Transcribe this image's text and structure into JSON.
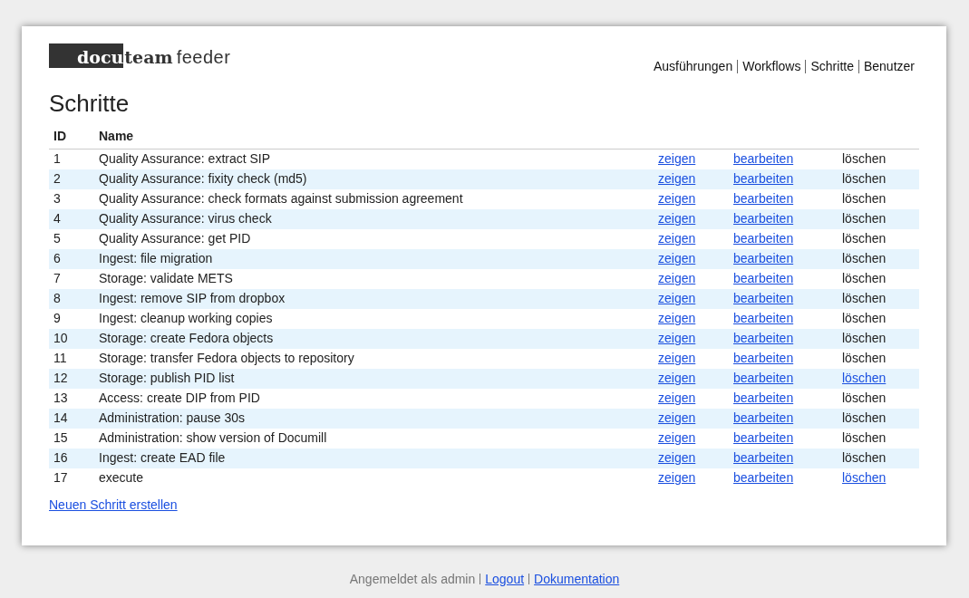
{
  "logo": {
    "dark_part": "docu",
    "bold_part": "team",
    "light_part": "feeder"
  },
  "nav": [
    "Ausführungen",
    "Workflows",
    "Schritte",
    "Benutzer"
  ],
  "heading": "Schritte",
  "table": {
    "columns": [
      "ID",
      "Name"
    ],
    "rows": [
      {
        "id": "1",
        "name": "Quality Assurance: extract SIP",
        "show": "zeigen",
        "edit": "bearbeiten",
        "delete": "löschen",
        "delete_enabled": false
      },
      {
        "id": "2",
        "name": "Quality Assurance: fixity check (md5)",
        "show": "zeigen",
        "edit": "bearbeiten",
        "delete": "löschen",
        "delete_enabled": false
      },
      {
        "id": "3",
        "name": "Quality Assurance: check formats against submission agreement",
        "show": "zeigen",
        "edit": "bearbeiten",
        "delete": "löschen",
        "delete_enabled": false
      },
      {
        "id": "4",
        "name": "Quality Assurance: virus check",
        "show": "zeigen",
        "edit": "bearbeiten",
        "delete": "löschen",
        "delete_enabled": false
      },
      {
        "id": "5",
        "name": "Quality Assurance: get PID",
        "show": "zeigen",
        "edit": "bearbeiten",
        "delete": "löschen",
        "delete_enabled": false
      },
      {
        "id": "6",
        "name": "Ingest: file migration",
        "show": "zeigen",
        "edit": "bearbeiten",
        "delete": "löschen",
        "delete_enabled": false
      },
      {
        "id": "7",
        "name": "Storage: validate METS",
        "show": "zeigen",
        "edit": "bearbeiten",
        "delete": "löschen",
        "delete_enabled": false
      },
      {
        "id": "8",
        "name": "Ingest: remove SIP from dropbox",
        "show": "zeigen",
        "edit": "bearbeiten",
        "delete": "löschen",
        "delete_enabled": false
      },
      {
        "id": "9",
        "name": "Ingest: cleanup working copies",
        "show": "zeigen",
        "edit": "bearbeiten",
        "delete": "löschen",
        "delete_enabled": false
      },
      {
        "id": "10",
        "name": "Storage: create Fedora objects",
        "show": "zeigen",
        "edit": "bearbeiten",
        "delete": "löschen",
        "delete_enabled": false
      },
      {
        "id": "11",
        "name": "Storage: transfer Fedora objects to repository",
        "show": "zeigen",
        "edit": "bearbeiten",
        "delete": "löschen",
        "delete_enabled": false
      },
      {
        "id": "12",
        "name": "Storage: publish PID list",
        "show": "zeigen",
        "edit": "bearbeiten",
        "delete": "löschen",
        "delete_enabled": true
      },
      {
        "id": "13",
        "name": "Access: create DIP from PID",
        "show": "zeigen",
        "edit": "bearbeiten",
        "delete": "löschen",
        "delete_enabled": false
      },
      {
        "id": "14",
        "name": "Administration: pause 30s",
        "show": "zeigen",
        "edit": "bearbeiten",
        "delete": "löschen",
        "delete_enabled": false
      },
      {
        "id": "15",
        "name": "Administration: show version of Documill",
        "show": "zeigen",
        "edit": "bearbeiten",
        "delete": "löschen",
        "delete_enabled": false
      },
      {
        "id": "16",
        "name": "Ingest: create EAD file",
        "show": "zeigen",
        "edit": "bearbeiten",
        "delete": "löschen",
        "delete_enabled": false
      },
      {
        "id": "17",
        "name": "execute",
        "show": "zeigen",
        "edit": "bearbeiten",
        "delete": "löschen",
        "delete_enabled": true
      }
    ]
  },
  "new_link": "Neuen Schritt erstellen",
  "footer": {
    "text": "Angemeldet als admin",
    "links": [
      "Logout",
      "Dokumentation"
    ]
  }
}
